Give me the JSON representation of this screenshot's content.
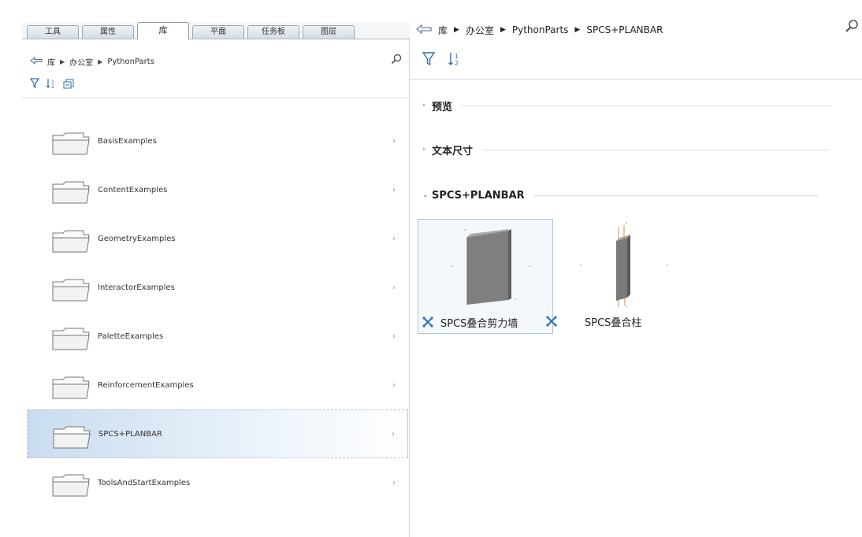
{
  "left_panel": {
    "tabs": [
      {
        "label": "工具",
        "active": false
      },
      {
        "label": "属性",
        "active": false
      },
      {
        "label": "库",
        "active": true
      },
      {
        "label": "平面",
        "active": false
      },
      {
        "label": "任务板",
        "active": false
      },
      {
        "label": "图层",
        "active": false
      }
    ],
    "breadcrumb": [
      "库",
      "办公室",
      "PythonParts"
    ],
    "items": [
      {
        "label": "BasisExamples",
        "selected": false
      },
      {
        "label": "ContentExamples",
        "selected": false
      },
      {
        "label": "GeometryExamples",
        "selected": false
      },
      {
        "label": "InteractorExamples",
        "selected": false
      },
      {
        "label": "PaletteExamples",
        "selected": false
      },
      {
        "label": "ReinforcementExamples",
        "selected": false
      },
      {
        "label": "SPCS+PLANBAR",
        "selected": true
      },
      {
        "label": "ToolsAndStartExamples",
        "selected": false
      }
    ],
    "chevron": "›"
  },
  "right_panel": {
    "breadcrumb": [
      "库",
      "办公室",
      "PythonParts",
      "SPCS+PLANBAR"
    ],
    "sections": [
      {
        "label": "预览",
        "expanded": false
      },
      {
        "label": "文本尺寸",
        "expanded": false
      },
      {
        "label": "SPCS+PLANBAR",
        "expanded": true
      }
    ],
    "items": [
      {
        "label": "SPCS叠合剪力墙",
        "selected": true
      },
      {
        "label": "SPCS叠合柱",
        "selected": false
      }
    ]
  },
  "icons": {
    "back": "back-arrow-icon",
    "search": "search-icon",
    "filter": "filter-icon",
    "sort": "sort-icon",
    "folder": "folder-icon",
    "python_part": "python-part-icon"
  },
  "colors": {
    "selection": "#c9dcef",
    "tab_border": "#9aa7b6",
    "accent_icon": "#2e6fb5"
  }
}
